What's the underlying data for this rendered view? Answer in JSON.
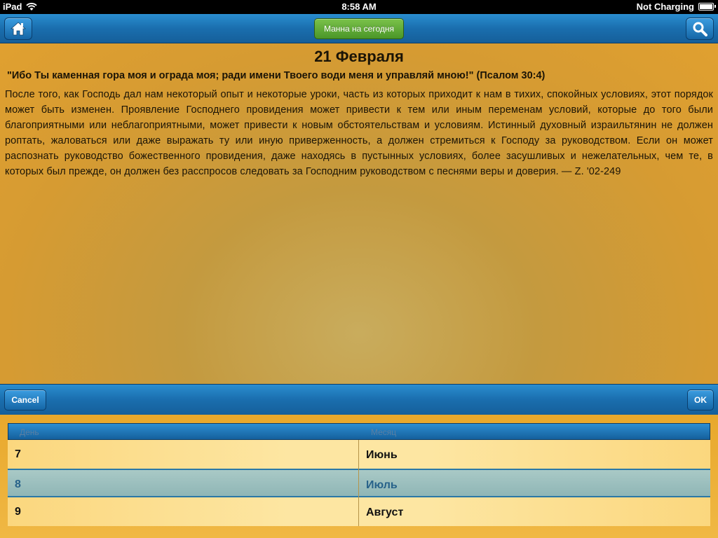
{
  "status_bar": {
    "carrier": "iPad",
    "time": "8:58 AM",
    "battery_text": "Not Charging"
  },
  "toolbar": {
    "center_button": "Манна на сегодня",
    "left_icon": "home-icon",
    "right_icon": "search-icon"
  },
  "content": {
    "date_title": "21 Февраля",
    "verse": "\"Ибо Ты каменная гора моя и ограда моя; ради имени Твоего води меня и управляй мною!\" (Псалом 30:4)",
    "body": "После того, как Господь дал нам некоторый опыт и некоторые уроки, часть из которых приходит к нам в тихих, спокойных условиях, этот порядок может быть изменен. Проявление Господнего провидения может привести к тем или иным переменам условий, которые до того были благоприятными или неблагоприятными, может привести к новым обстоятельствам и условиям. Истинный духовный израильтянин не должен роптать, жаловаться или даже выражать ту или иную приверженность, а должен стремиться к Господу за руководством. Если он может распознать руководство божественного провидения, даже находясь в пустынных условиях, более засушливых и нежелательных, чем те, в которых был прежде, он должен без расспросов следовать за Господним руководством с песнями веры и доверия. — Z. '02-249"
  },
  "picker_toolbar": {
    "cancel_label": "Cancel",
    "ok_label": "OK"
  },
  "picker": {
    "header": {
      "day": "День",
      "month": "Месяц"
    },
    "rows": [
      {
        "day": "7",
        "month": "Июнь"
      },
      {
        "day": "8",
        "month": "Июль"
      },
      {
        "day": "9",
        "month": "Август"
      }
    ],
    "selected_index": 1
  },
  "colors": {
    "toolbar_blue": "#1a6eae",
    "manna_green": "#5aa632",
    "content_gold": "#d69b32",
    "selected_row": "#9fc1bf"
  }
}
